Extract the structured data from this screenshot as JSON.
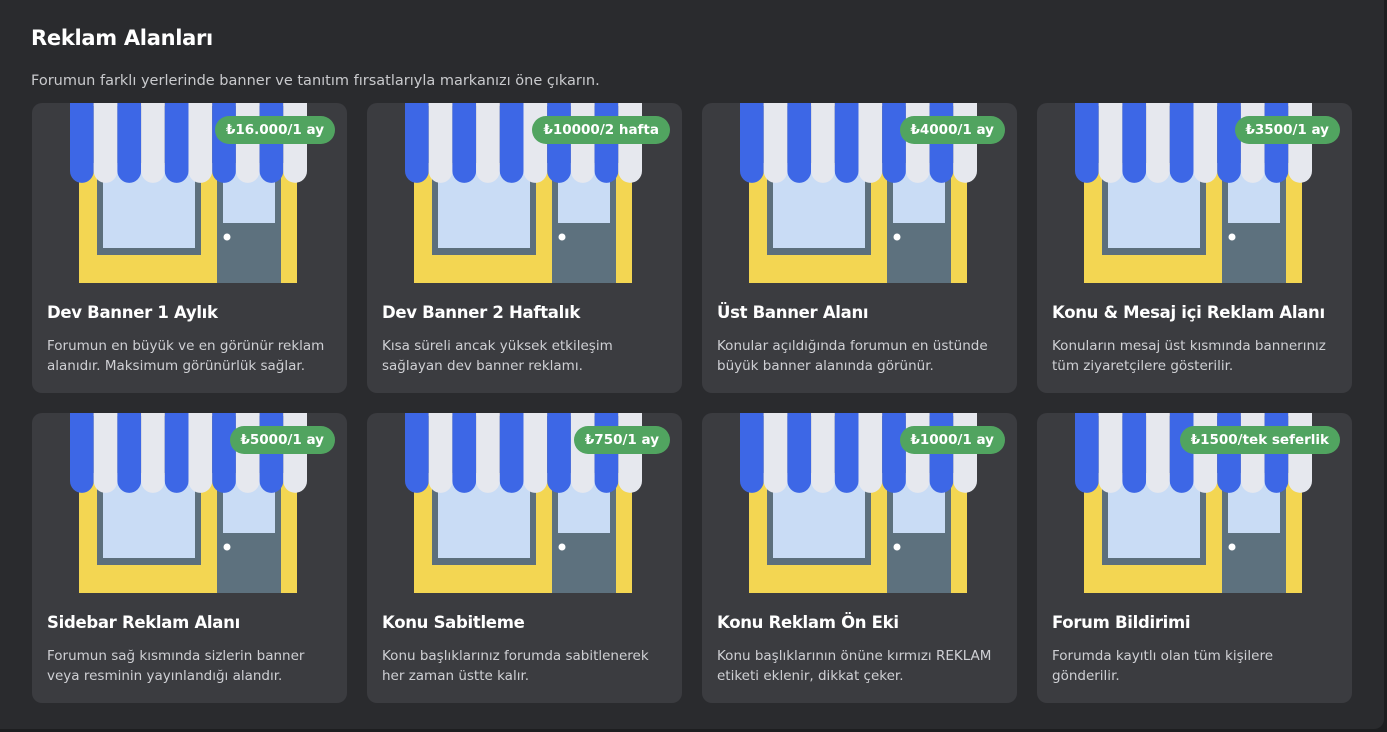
{
  "header": {
    "title": "Reklam Alanları",
    "subtitle": "Forumun farklı yerlerinde banner ve tanıtım fırsatlarıyla markanızı öne çıkarın."
  },
  "colors": {
    "background": "#2a2b2e",
    "card": "#3b3c40",
    "price_badge": "#51a460",
    "awning_blue": "#3d67e6",
    "awning_white": "#e6e8ee",
    "shop_wall": "#f3d652",
    "window": "#c9dcf5",
    "door": "#5d717e"
  },
  "cards": [
    {
      "price": "₺16.000/1 ay",
      "title": "Dev Banner 1 Aylık",
      "description": "Forumun en büyük ve en görünür reklam alanıdır. Maksimum görünürlük sağlar.",
      "icon": "storefront-icon"
    },
    {
      "price": "₺10000/2 hafta",
      "title": "Dev Banner 2 Haftalık",
      "description": "Kısa süreli ancak yüksek etkileşim sağlayan dev banner reklamı.",
      "icon": "storefront-icon"
    },
    {
      "price": "₺4000/1 ay",
      "title": "Üst Banner Alanı",
      "description": "Konular açıldığında forumun en üstünde büyük banner alanında görünür.",
      "icon": "storefront-icon"
    },
    {
      "price": "₺3500/1 ay",
      "title": "Konu & Mesaj içi Reklam Alanı",
      "description": "Konuların mesaj üst kısmında bannerınız tüm ziyaretçilere gösterilir.",
      "icon": "storefront-icon"
    },
    {
      "price": "₺5000/1 ay",
      "title": "Sidebar Reklam Alanı",
      "description": "Forumun sağ kısmında sizlerin banner veya resminin yayınlandığı alandır.",
      "icon": "storefront-icon"
    },
    {
      "price": "₺750/1 ay",
      "title": "Konu Sabitleme",
      "description": "Konu başlıklarınız forumda sabitlenerek her zaman üstte kalır.",
      "icon": "storefront-icon"
    },
    {
      "price": "₺1000/1 ay",
      "title": "Konu Reklam Ön Eki",
      "description": "Konu başlıklarının önüne kırmızı REKLAM etiketi eklenir, dikkat çeker.",
      "icon": "storefront-icon"
    },
    {
      "price": "₺1500/tek seferlik",
      "title": "Forum Bildirimi",
      "description": "Forumda kayıtlı olan tüm kişilere gönderilir.",
      "icon": "storefront-icon"
    }
  ]
}
